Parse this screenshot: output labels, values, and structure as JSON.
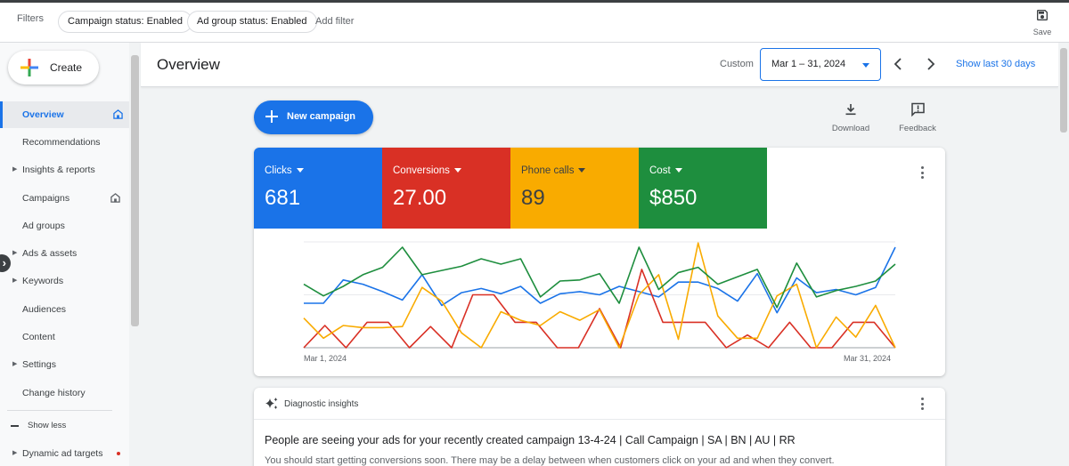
{
  "filters": {
    "label": "Filters",
    "chips": [
      "Campaign status: Enabled",
      "Ad group status: Enabled"
    ],
    "add_filter": "Add filter",
    "save_label": "Save"
  },
  "sidebar": {
    "create_label": "Create",
    "items": [
      {
        "label": "Overview",
        "active": true,
        "home": true
      },
      {
        "label": "Recommendations"
      },
      {
        "label": "Insights & reports",
        "expandable": true
      },
      {
        "label": "Campaigns",
        "home": true
      },
      {
        "label": "Ad groups"
      },
      {
        "label": "Ads & assets",
        "expandable": true
      },
      {
        "label": "Keywords",
        "expandable": true
      },
      {
        "label": "Audiences"
      },
      {
        "label": "Content"
      },
      {
        "label": "Settings",
        "expandable": true
      },
      {
        "label": "Change history"
      }
    ],
    "show_less": "Show less",
    "dynamic_ad_targets": "Dynamic ad targets"
  },
  "header": {
    "title": "Overview",
    "custom_label": "Custom",
    "date_range": "Mar 1 – 31, 2024",
    "show_last": "Show last 30 days"
  },
  "toolbar": {
    "new_campaign": "New campaign",
    "download": "Download",
    "feedback": "Feedback"
  },
  "metrics": [
    {
      "name": "Clicks",
      "value": "681",
      "color": "#1a73e8"
    },
    {
      "name": "Conversions",
      "value": "27.00",
      "color": "#d93025"
    },
    {
      "name": "Phone calls",
      "value": "89",
      "color": "#f9ab00"
    },
    {
      "name": "Cost",
      "value": "$850",
      "color": "#1e8e3e"
    }
  ],
  "chart_data": {
    "type": "line",
    "x_start": "Mar 1, 2024",
    "x_end": "Mar 31, 2024",
    "x": [
      1,
      2,
      3,
      4,
      5,
      6,
      7,
      8,
      9,
      10,
      11,
      12,
      13,
      14,
      15,
      16,
      17,
      18,
      19,
      20,
      21,
      22,
      23,
      24,
      25,
      26,
      27,
      28,
      29,
      30,
      31
    ],
    "grid": true,
    "ylim": [
      0,
      100
    ],
    "series": [
      {
        "name": "Clicks",
        "color": "#1a73e8",
        "values": [
          42,
          42,
          64,
          60,
          53,
          45,
          69,
          40,
          52,
          56,
          51,
          58,
          42,
          51,
          53,
          50,
          58,
          53,
          48,
          62,
          62,
          56,
          44,
          70,
          33,
          66,
          52,
          55,
          50,
          57,
          95
        ]
      },
      {
        "name": "Conversions",
        "color": "#d93025",
        "values": [
          0,
          21,
          0,
          24,
          24,
          0,
          20,
          0,
          50,
          50,
          24,
          24,
          0,
          0,
          37,
          0,
          74,
          24,
          24,
          24,
          0,
          12,
          0,
          24,
          0,
          0,
          24,
          24,
          0
        ]
      },
      {
        "name": "Phone calls",
        "color": "#f9ab00",
        "values": [
          28,
          9,
          21,
          19,
          19,
          20,
          57,
          44,
          14,
          0,
          34,
          26,
          21,
          34,
          26,
          36,
          0,
          50,
          69,
          8,
          99,
          30,
          9,
          9,
          49,
          60,
          0,
          29,
          10,
          40,
          0
        ]
      },
      {
        "name": "Cost",
        "color": "#1e8e3e",
        "values": [
          60,
          49,
          58,
          69,
          76,
          95,
          69,
          73,
          77,
          84,
          79,
          84,
          48,
          63,
          64,
          70,
          42,
          95,
          55,
          71,
          76,
          60,
          67,
          74,
          38,
          80,
          48,
          54,
          58,
          63,
          79
        ]
      }
    ]
  },
  "insights": {
    "title": "Diagnostic insights",
    "headline": "People are seeing your ads for your recently created campaign 13-4-24 | Call Campaign | SA | BN | AU | RR",
    "body": "You should start getting conversions soon. There may be a delay between when customers click on your ad and when they convert."
  }
}
